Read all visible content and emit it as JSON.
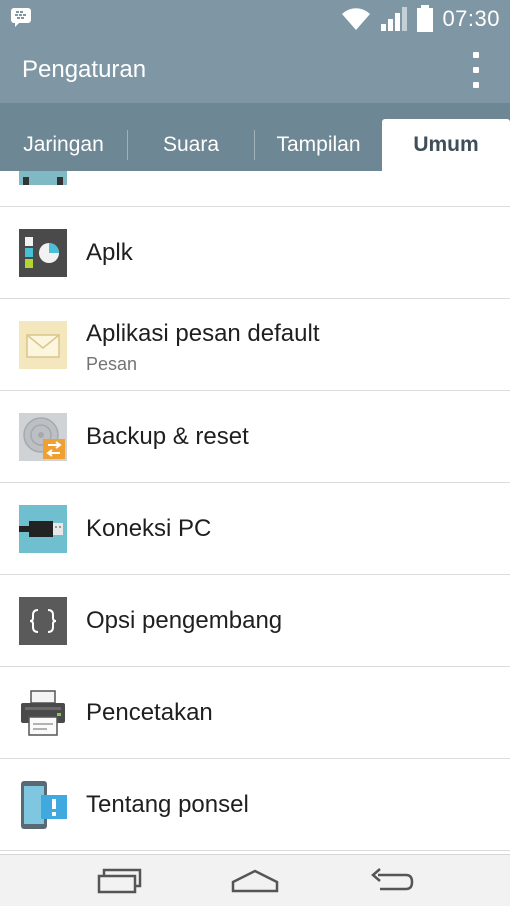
{
  "status_bar": {
    "time": "07:30"
  },
  "header": {
    "title": "Pengaturan"
  },
  "tabs": [
    {
      "label": "Jaringan"
    },
    {
      "label": "Suara"
    },
    {
      "label": "Tampilan"
    },
    {
      "label": "Umum"
    }
  ],
  "active_tab": "Umum",
  "list": {
    "items": [
      {
        "label": "Aplk",
        "icon": "apps-icon"
      },
      {
        "label": "Aplikasi pesan default",
        "sub": "Pesan",
        "icon": "envelope-icon"
      },
      {
        "label": "Backup & reset",
        "icon": "backup-disk-icon"
      },
      {
        "label": "Koneksi PC",
        "icon": "usb-cable-icon"
      },
      {
        "label": "Opsi pengembang",
        "icon": "braces-icon"
      },
      {
        "label": "Pencetakan",
        "icon": "printer-icon"
      },
      {
        "label": "Tentang ponsel",
        "icon": "phone-info-icon"
      }
    ]
  },
  "navigation": {
    "buttons": [
      "recent-apps",
      "home",
      "back"
    ]
  },
  "colors": {
    "header": "#7f97a4",
    "tab_bar": "#6d8794",
    "active_tab_text": "#3f4f5a",
    "accent_orange": "#f0a030"
  }
}
